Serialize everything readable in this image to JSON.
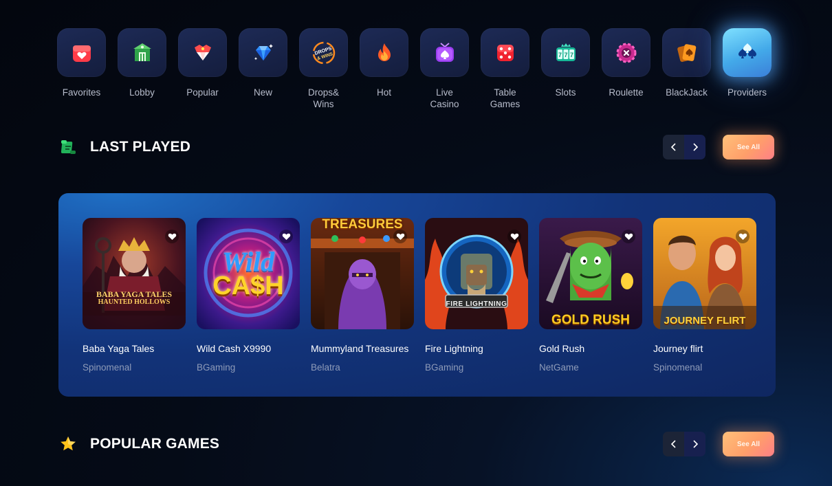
{
  "categories": [
    {
      "label": "Favorites",
      "icon": "favorites-icon"
    },
    {
      "label": "Lobby",
      "icon": "lobby-icon"
    },
    {
      "label": "Popular",
      "icon": "popular-icon"
    },
    {
      "label": "New",
      "icon": "diamond-icon"
    },
    {
      "label": "Drops&\nWins",
      "icon": "drops-wins-icon",
      "badge": "DROPS & WINS"
    },
    {
      "label": "Hot",
      "icon": "flame-icon"
    },
    {
      "label": "Live\nCasino",
      "icon": "live-casino-icon"
    },
    {
      "label": "Table\nGames",
      "icon": "dice-icon"
    },
    {
      "label": "Slots",
      "icon": "slots-icon",
      "badge": "777"
    },
    {
      "label": "Roulette",
      "icon": "roulette-icon"
    },
    {
      "label": "BlackJack",
      "icon": "cards-icon"
    },
    {
      "label": "Providers",
      "icon": "providers-icon",
      "active": true
    }
  ],
  "last_played": {
    "title": "LAST PLAYED",
    "see_all": "See All",
    "games": [
      {
        "name": "Baba Yaga Tales",
        "provider": "Spinomenal",
        "art_text": [
          "BABA YAGA TALES",
          "HAUNTED HOLLOWS"
        ]
      },
      {
        "name": "Wild Cash X9990",
        "provider": "BGaming",
        "art_text": [
          "Wild",
          "CA$H"
        ]
      },
      {
        "name": "Mummyland Treasures",
        "provider": "Belatra",
        "art_text": [
          "TREASURES"
        ]
      },
      {
        "name": "Fire Lightning",
        "provider": "BGaming",
        "art_text": [
          "FIRE LIGHTNING"
        ]
      },
      {
        "name": "Gold Rush",
        "provider": "NetGame",
        "art_text": [
          "GOLD RUSH"
        ]
      },
      {
        "name": "Journey flirt",
        "provider": "Spinomenal",
        "art_text": [
          "JOURNEY FLIRT"
        ]
      }
    ]
  },
  "popular_games": {
    "title": "POPULAR GAMES",
    "see_all": "See All"
  },
  "colors": {
    "background": "#050b17",
    "panel": "#123379",
    "tile": "#1a2650",
    "active_tile": "#5cc6f5",
    "see_all_gradient": [
      "#ffc07a",
      "#ff7f86"
    ],
    "muted_text": "#b7bccb"
  }
}
